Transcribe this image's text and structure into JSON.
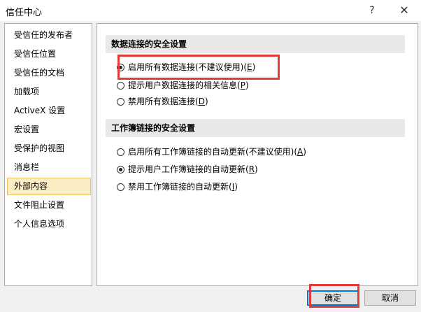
{
  "window": {
    "title": "信任中心",
    "help_label": "?",
    "close_label": "✕"
  },
  "sidebar": {
    "items": [
      {
        "label": "受信任的发布者",
        "selected": false
      },
      {
        "label": "受信任位置",
        "selected": false
      },
      {
        "label": "受信任的文档",
        "selected": false
      },
      {
        "label": "加载项",
        "selected": false
      },
      {
        "label": "ActiveX 设置",
        "selected": false
      },
      {
        "label": "宏设置",
        "selected": false
      },
      {
        "label": "受保护的视图",
        "selected": false
      },
      {
        "label": "消息栏",
        "selected": false
      },
      {
        "label": "外部内容",
        "selected": true
      },
      {
        "label": "文件阻止设置",
        "selected": false
      },
      {
        "label": "个人信息选项",
        "selected": false
      }
    ]
  },
  "data_connections": {
    "header": "数据连接的安全设置",
    "options": [
      {
        "label": "启用所有数据连接(不建议使用)(",
        "key": "E",
        "suffix": ")",
        "checked": true
      },
      {
        "label": "提示用户数据连接的相关信息(",
        "key": "P",
        "suffix": ")",
        "checked": false
      },
      {
        "label": "禁用所有数据连接(",
        "key": "D",
        "suffix": ")",
        "checked": false
      }
    ]
  },
  "workbook_links": {
    "header": "工作簿链接的安全设置",
    "options": [
      {
        "label": "启用所有工作簿链接的自动更新(不建议使用)(",
        "key": "A",
        "suffix": ")",
        "checked": false
      },
      {
        "label": "提示用户工作簿链接的自动更新(",
        "key": "R",
        "suffix": ")",
        "checked": true
      },
      {
        "label": "禁用工作簿链接的自动更新(",
        "key": "I",
        "suffix": ")",
        "checked": false
      }
    ]
  },
  "footer": {
    "ok_label": "确定",
    "cancel_label": "取消"
  },
  "colors": {
    "highlight": "#e53a3a",
    "selected_bg": "#fcedc5",
    "default_button_border": "#0078d7"
  }
}
